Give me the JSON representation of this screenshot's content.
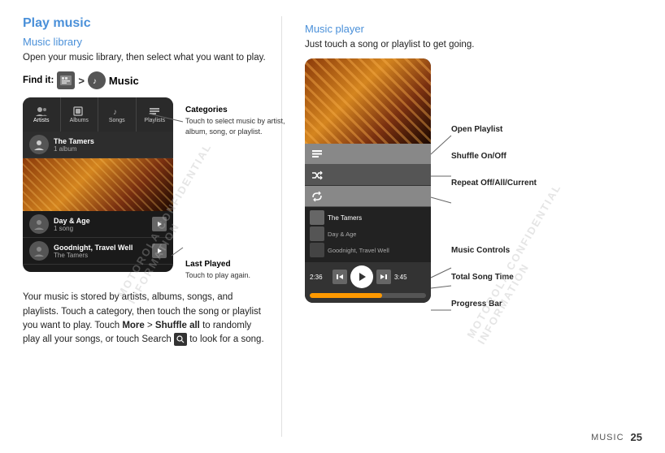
{
  "header": {
    "play_music": "Play music",
    "music_library": "Music library"
  },
  "left": {
    "intro_text": "Open your music library, then select what you want to play.",
    "find_it_label": "Find it:",
    "chevron": ">",
    "music_word": "Music",
    "categories_title": "Categories",
    "categories_desc": "Touch to select music by artist, album, song, or playlist.",
    "last_played_title": "Last Played",
    "last_played_desc": "Touch to play again.",
    "bottom_text_1": "Your music is stored by artists, albums, songs, and playlists. Touch a category, then touch the song or playlist you want to play. Touch ",
    "bottom_bold": "More",
    "bottom_text_2": " > ",
    "bottom_bold2": "Shuffle all",
    "bottom_text_3": " to randomly play all your songs, or touch Search ",
    "bottom_text_4": " to look for a song."
  },
  "phone_left": {
    "tabs": [
      "Artists",
      "Albums",
      "Songs",
      "Playlists"
    ],
    "items": [
      {
        "name": "The Tamers",
        "sub": "1 album"
      },
      {
        "name": "Day & Age",
        "sub": "1 song"
      }
    ],
    "last_item": {
      "name": "Goodnight, Travel Well",
      "sub": "The Tamers"
    }
  },
  "right": {
    "music_player_title": "Music player",
    "music_player_desc": "Just touch a song or playlist to get going.",
    "open_playlist": "Open Playlist",
    "shuffle": "Shuffle On/Off",
    "repeat": "Repeat Off/All/Current",
    "music_controls": "Music Controls",
    "total_song_time": "Total Song Time",
    "progress_bar": "Progress Bar",
    "artist": "The Tamers",
    "album": "Day & Age",
    "song": "Goodnight, Travel Well",
    "time_elapsed": "2:36",
    "time_total": "3:45",
    "progress_pct": 62
  },
  "footer": {
    "music_label": "MUSIC",
    "page_number": "25"
  }
}
